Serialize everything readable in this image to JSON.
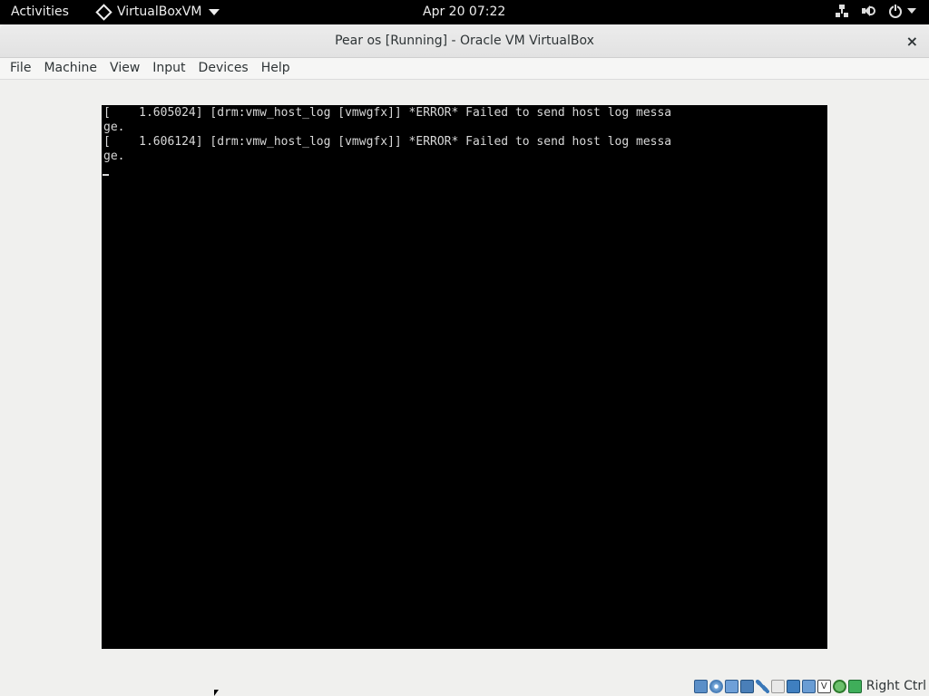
{
  "topbar": {
    "activities": "Activities",
    "app_name": "VirtualBoxVM",
    "clock": "Apr 20  07:22",
    "icons": [
      "network-icon",
      "volume-icon",
      "power-icon"
    ]
  },
  "window": {
    "title": "Pear os [Running] - Oracle VM VirtualBox",
    "close_label": "×"
  },
  "menubar": {
    "items": [
      "File",
      "Machine",
      "View",
      "Input",
      "Devices",
      "Help"
    ]
  },
  "console": {
    "lines": [
      "[    1.605024] [drm:vmw_host_log [vmwgfx]] *ERROR* Failed to send host log messa",
      "ge.",
      "[    1.606124] [drm:vmw_host_log [vmwgfx]] *ERROR* Failed to send host log messa",
      "ge."
    ]
  },
  "statusbar": {
    "icons": [
      "hard-disk-icon",
      "optical-drive-icon",
      "audio-icon",
      "network-adapter-icon",
      "usb-icon",
      "shared-folders-icon",
      "display-icon",
      "recording-icon",
      "virtualization-icon",
      "mouse-integration-icon",
      "keyboard-icon"
    ],
    "vtx_glyph": "V",
    "host_key": "Right Ctrl"
  }
}
